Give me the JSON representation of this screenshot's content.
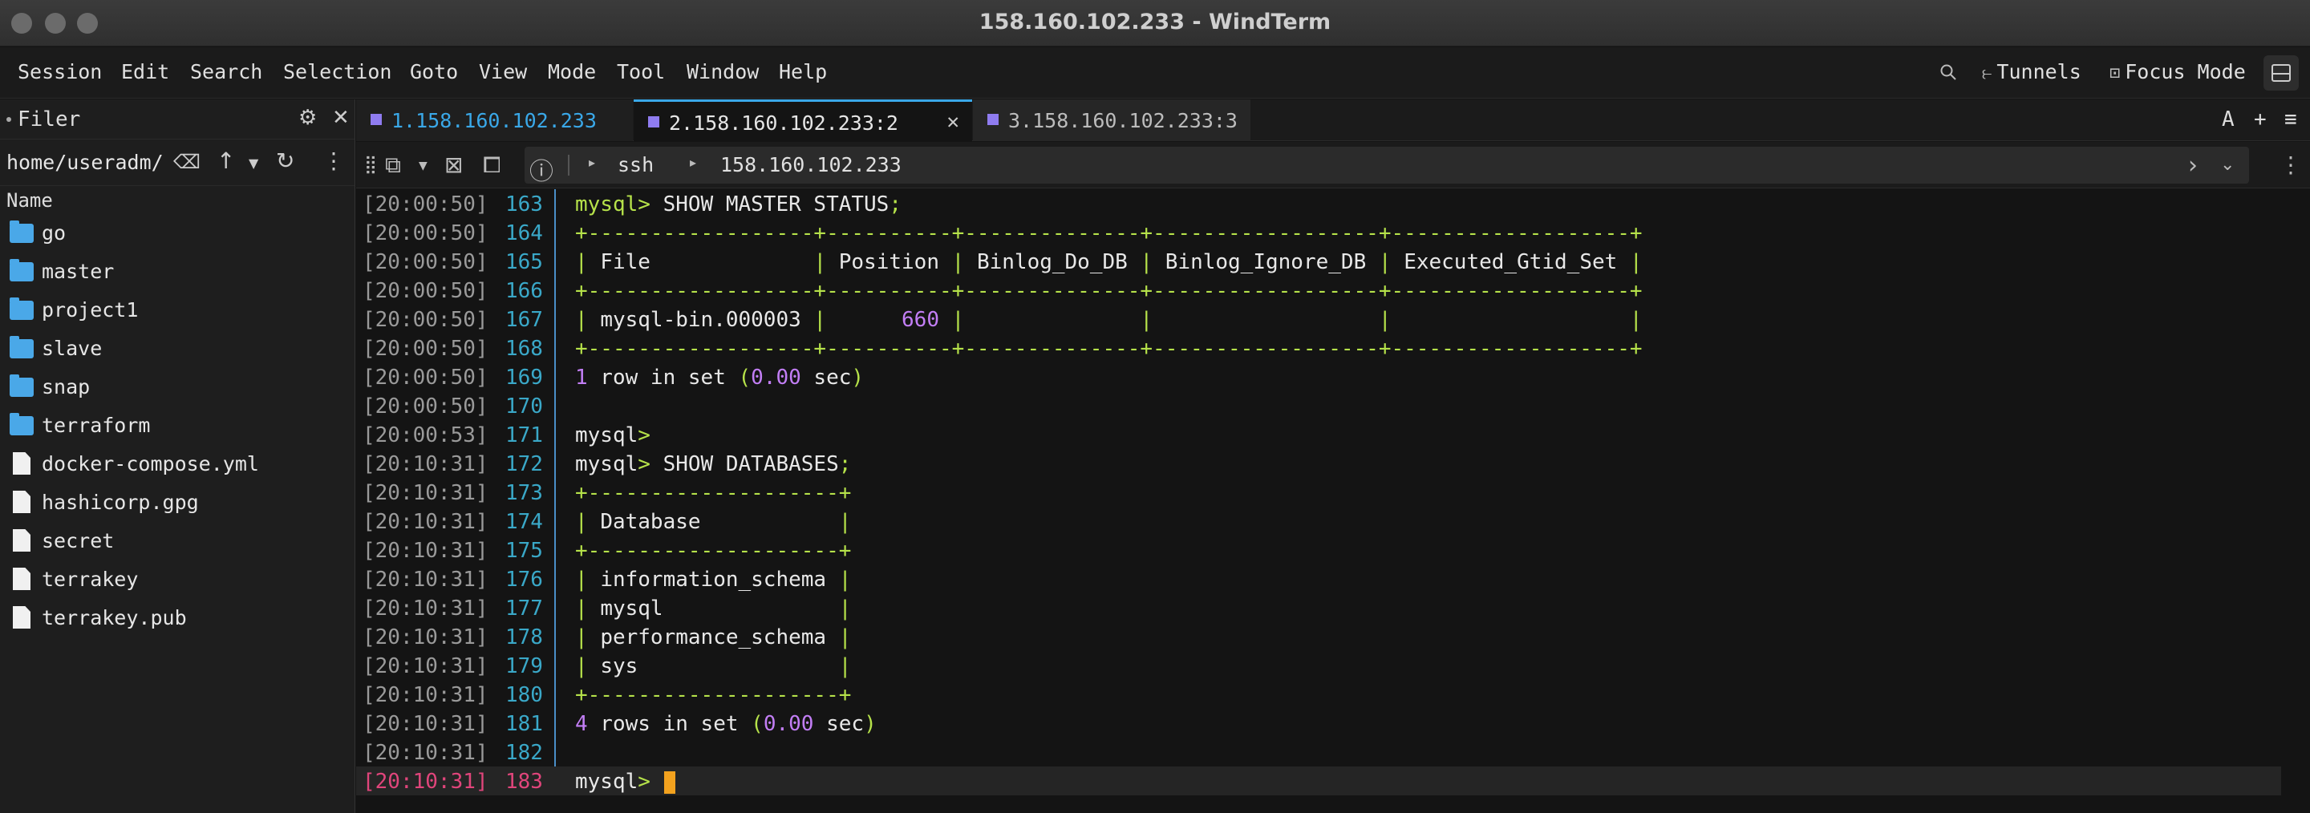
{
  "window": {
    "title": "158.160.102.233 - WindTerm"
  },
  "menu": {
    "items": [
      "Session",
      "Edit",
      "Search",
      "Selection",
      "Goto",
      "View",
      "Mode",
      "Tool",
      "Window",
      "Help"
    ],
    "tunnels_label": "Tunnels",
    "focus_label": "Focus Mode"
  },
  "filer": {
    "title": "Filer",
    "path": "home/useradm/",
    "column_name": "Name",
    "entries": [
      {
        "name": "go",
        "type": "folder"
      },
      {
        "name": "master",
        "type": "folder"
      },
      {
        "name": "project1",
        "type": "folder"
      },
      {
        "name": "slave",
        "type": "folder"
      },
      {
        "name": "snap",
        "type": "folder"
      },
      {
        "name": "terraform",
        "type": "folder"
      },
      {
        "name": "docker-compose.yml",
        "type": "file"
      },
      {
        "name": "hashicorp.gpg",
        "type": "file"
      },
      {
        "name": "secret",
        "type": "file"
      },
      {
        "name": "terrakey",
        "type": "file"
      },
      {
        "name": "terrakey.pub",
        "type": "file"
      }
    ]
  },
  "tabs": [
    {
      "label": "1.158.160.102.233",
      "active": false,
      "color": "#3aa8e8"
    },
    {
      "label": "2.158.160.102.233:2",
      "active": true,
      "color": "#e6e6e6"
    },
    {
      "label": "3.158.160.102.233:3",
      "active": false,
      "color": "#bcbcbc"
    }
  ],
  "tabbar_right": {
    "font_btn": "A",
    "add_btn": "+",
    "menu_btn": "≡"
  },
  "address": {
    "protocol": "ssh",
    "host": "158.160.102.233"
  },
  "terminal": {
    "lines": [
      {
        "ts": "[20:00:50]",
        "ln": "163",
        "segs": [
          [
            "g",
            "mysql> "
          ],
          [
            "",
            "SHOW MASTER STATUS"
          ],
          [
            "g",
            ";"
          ]
        ]
      },
      {
        "ts": "[20:00:50]",
        "ln": "164",
        "segs": [
          [
            "g",
            "+------------------+----------+--------------+------------------+-------------------+"
          ]
        ]
      },
      {
        "ts": "[20:00:50]",
        "ln": "165",
        "segs": [
          [
            "g",
            "| "
          ],
          [
            "",
            "File"
          ],
          [
            "",
            "             "
          ],
          [
            "g",
            "| "
          ],
          [
            "",
            "Position"
          ],
          [
            "g",
            " | "
          ],
          [
            "",
            "Binlog_Do_DB"
          ],
          [
            "g",
            " | "
          ],
          [
            "",
            "Binlog_Ignore_DB"
          ],
          [
            "g",
            " | "
          ],
          [
            "",
            "Executed_Gtid_Set"
          ],
          [
            "g",
            " |"
          ]
        ]
      },
      {
        "ts": "[20:00:50]",
        "ln": "166",
        "segs": [
          [
            "g",
            "+------------------+----------+--------------+------------------+-------------------+"
          ]
        ]
      },
      {
        "ts": "[20:00:50]",
        "ln": "167",
        "segs": [
          [
            "g",
            "| "
          ],
          [
            "",
            "mysql-bin.000003"
          ],
          [
            "g",
            " | "
          ],
          [
            "",
            "     "
          ],
          [
            "p",
            "660"
          ],
          [
            "g",
            " |              |                  |                   |"
          ]
        ]
      },
      {
        "ts": "[20:00:50]",
        "ln": "168",
        "segs": [
          [
            "g",
            "+------------------+----------+--------------+------------------+-------------------+"
          ]
        ]
      },
      {
        "ts": "[20:00:50]",
        "ln": "169",
        "segs": [
          [
            "p",
            "1"
          ],
          [
            "",
            " row in set "
          ],
          [
            "g",
            "("
          ],
          [
            "p",
            "0.00"
          ],
          [
            "",
            " sec"
          ],
          [
            "g",
            ")"
          ]
        ]
      },
      {
        "ts": "[20:00:50]",
        "ln": "170",
        "segs": []
      },
      {
        "ts": "[20:00:53]",
        "ln": "171",
        "segs": [
          [
            "",
            "mysql"
          ],
          [
            "g",
            ">"
          ]
        ]
      },
      {
        "ts": "[20:10:31]",
        "ln": "172",
        "segs": [
          [
            "",
            "mysql"
          ],
          [
            "g",
            "> "
          ],
          [
            "",
            "SHOW DATABASES"
          ],
          [
            "g",
            ";"
          ]
        ]
      },
      {
        "ts": "[20:10:31]",
        "ln": "173",
        "segs": [
          [
            "g",
            "+--------------------+"
          ]
        ]
      },
      {
        "ts": "[20:10:31]",
        "ln": "174",
        "segs": [
          [
            "g",
            "| "
          ],
          [
            "",
            "Database"
          ],
          [
            "",
            "           "
          ],
          [
            "g",
            "|"
          ]
        ]
      },
      {
        "ts": "[20:10:31]",
        "ln": "175",
        "segs": [
          [
            "g",
            "+--------------------+"
          ]
        ]
      },
      {
        "ts": "[20:10:31]",
        "ln": "176",
        "segs": [
          [
            "g",
            "| "
          ],
          [
            "",
            "information_schema"
          ],
          [
            "g",
            " |"
          ]
        ]
      },
      {
        "ts": "[20:10:31]",
        "ln": "177",
        "segs": [
          [
            "g",
            "| "
          ],
          [
            "",
            "mysql"
          ],
          [
            "",
            "              "
          ],
          [
            "g",
            "|"
          ]
        ]
      },
      {
        "ts": "[20:10:31]",
        "ln": "178",
        "segs": [
          [
            "g",
            "| "
          ],
          [
            "",
            "performance_schema"
          ],
          [
            "g",
            " |"
          ]
        ]
      },
      {
        "ts": "[20:10:31]",
        "ln": "179",
        "segs": [
          [
            "g",
            "| "
          ],
          [
            "",
            "sys"
          ],
          [
            "",
            "                "
          ],
          [
            "g",
            "|"
          ]
        ]
      },
      {
        "ts": "[20:10:31]",
        "ln": "180",
        "segs": [
          [
            "g",
            "+--------------------+"
          ]
        ]
      },
      {
        "ts": "[20:10:31]",
        "ln": "181",
        "segs": [
          [
            "p",
            "4"
          ],
          [
            "",
            " rows in set "
          ],
          [
            "g",
            "("
          ],
          [
            "p",
            "0.00"
          ],
          [
            "",
            " sec"
          ],
          [
            "g",
            ")"
          ]
        ]
      },
      {
        "ts": "[20:10:31]",
        "ln": "182",
        "segs": []
      },
      {
        "ts": "[20:10:31]",
        "ln": "183",
        "segs": [
          [
            "",
            "mysql"
          ],
          [
            "g",
            "> "
          ]
        ],
        "current": true
      }
    ]
  },
  "colors": {
    "accent_green": "#b6e24a",
    "accent_purple": "#c27ef5",
    "line_number": "#3aa8c8",
    "current_line": "#e0457b",
    "cursor": "#f3a21e",
    "folder": "#4aa8e8"
  }
}
